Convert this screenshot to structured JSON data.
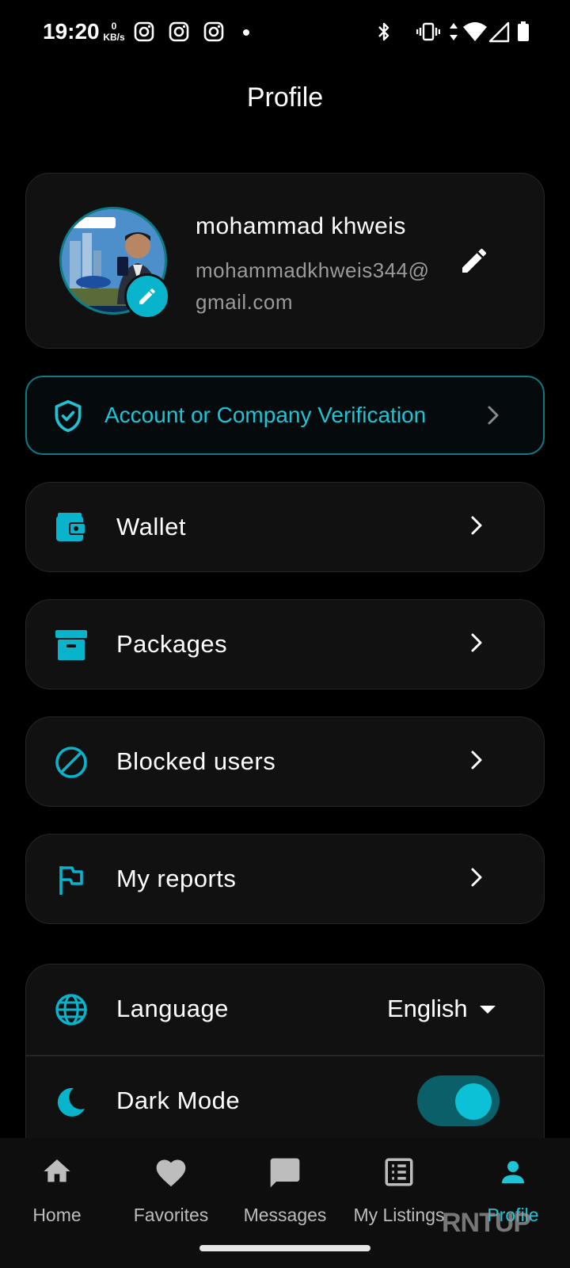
{
  "status_bar": {
    "time": "19:20",
    "net_speed_value": "0",
    "net_speed_unit": "KB/s"
  },
  "page": {
    "title": "Profile"
  },
  "profile": {
    "name": "mohammad khweis",
    "email": "mohammadkhweis344@gmail.com"
  },
  "verification": {
    "label": "Account or Company Verification"
  },
  "menu": [
    {
      "label": "Wallet",
      "icon": "wallet-icon"
    },
    {
      "label": "Packages",
      "icon": "package-icon"
    },
    {
      "label": "Blocked users",
      "icon": "block-icon"
    },
    {
      "label": "My reports",
      "icon": "flag-icon"
    }
  ],
  "settings": {
    "language_label": "Language",
    "language_value": "English",
    "dark_mode_label": "Dark Mode",
    "dark_mode_on": true
  },
  "nav": [
    {
      "label": "Home",
      "icon": "home-icon"
    },
    {
      "label": "Favorites",
      "icon": "heart-icon"
    },
    {
      "label": "Messages",
      "icon": "chat-icon"
    },
    {
      "label": "My Listings",
      "icon": "listings-icon"
    },
    {
      "label": "Profile",
      "icon": "person-icon",
      "active": true
    }
  ],
  "watermark": "RNTUP",
  "colors": {
    "accent": "#08b4cc",
    "background": "#000000",
    "card": "#111111"
  }
}
